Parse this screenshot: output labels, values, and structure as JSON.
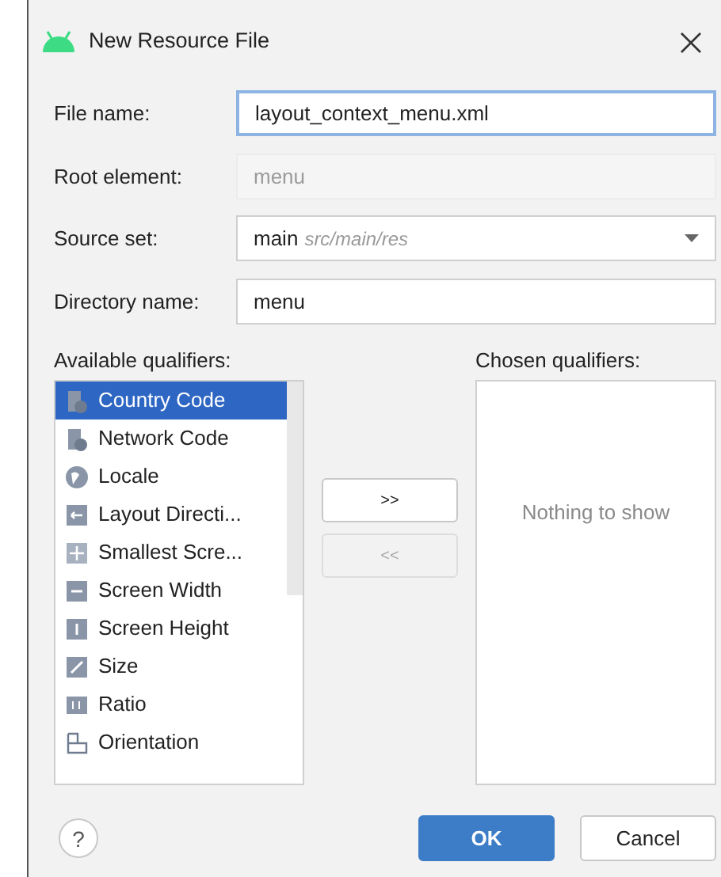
{
  "window": {
    "title": "New Resource File"
  },
  "fields": [
    {
      "kind": "text",
      "label": "File name:",
      "value": "layout_context_menu.xml",
      "focused": true,
      "disabled": false
    },
    {
      "kind": "text",
      "label": "Root element:",
      "value": "menu",
      "focused": false,
      "disabled": true
    },
    {
      "kind": "combo",
      "label": "Source set:",
      "value": "main",
      "hint": "src/main/res",
      "focused": false,
      "disabled": false
    },
    {
      "kind": "text",
      "label": "Directory name:",
      "value": "menu",
      "focused": false,
      "disabled": false
    }
  ],
  "available": {
    "label": "Available qualifiers:",
    "items": [
      {
        "label": "Country Code",
        "kind": "country",
        "selected": true
      },
      {
        "label": "Network Code",
        "kind": "network",
        "selected": false
      },
      {
        "label": "Locale",
        "kind": "locale",
        "selected": false
      },
      {
        "label": "Layout Directi...",
        "kind": "direction",
        "selected": false
      },
      {
        "label": "Smallest Scre...",
        "kind": "smallest",
        "selected": false
      },
      {
        "label": "Screen Width",
        "kind": "width",
        "selected": false
      },
      {
        "label": "Screen Height",
        "kind": "height",
        "selected": false
      },
      {
        "label": "Size",
        "kind": "size",
        "selected": false
      },
      {
        "label": "Ratio",
        "kind": "ratio",
        "selected": false
      },
      {
        "label": "Orientation",
        "kind": "orientation",
        "selected": false
      }
    ]
  },
  "move_buttons": [
    {
      "label": ">>",
      "disabled": false
    },
    {
      "label": "<<",
      "disabled": true
    }
  ],
  "chosen": {
    "label": "Chosen qualifiers:",
    "empty_text": "Nothing to show"
  },
  "help": {
    "label": "?"
  },
  "buttons": [
    {
      "label": "OK",
      "kind": "primary"
    },
    {
      "label": "Cancel",
      "kind": "secondary"
    }
  ]
}
